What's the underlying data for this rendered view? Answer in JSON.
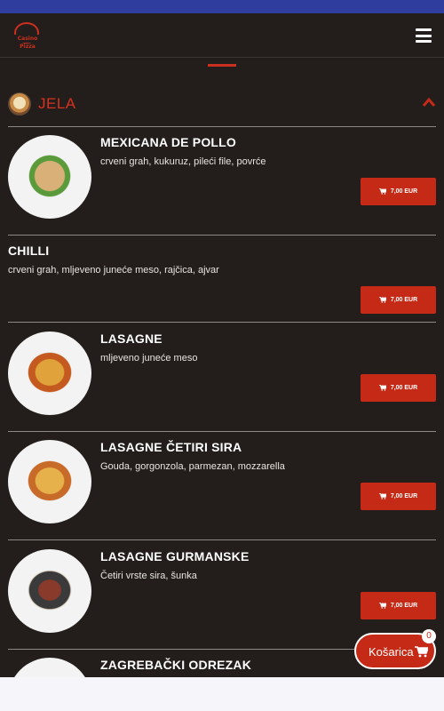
{
  "section": {
    "title": "JELA"
  },
  "logo": {
    "text": "Casino Pizza"
  },
  "items": [
    {
      "name": "MEXICANA DE POLLO",
      "description": "crveni grah, kukuruz, pileći file, povrće",
      "price": "7,00 EUR",
      "photo_icon": "tortilla-wrap"
    },
    {
      "name": "CHILLI",
      "description": "crveni grah, mljeveno juneće meso, rajčica, ajvar",
      "price": "7,00 EUR"
    },
    {
      "name": "LASAGNE",
      "description": "mljeveno juneće meso",
      "price": "7,00 EUR",
      "photo_icon": "lasagne-dish"
    },
    {
      "name": "LASAGNE ČETIRI SIRA",
      "description": "Gouda, gorgonzola, parmezan, mozzarella",
      "price": "7,00 EUR",
      "photo_icon": "lasagne-dish"
    },
    {
      "name": "LASAGNE GURMANSKE",
      "description": "Četiri vrste sira, šunka",
      "price": "7,00 EUR",
      "photo_icon": "lasagne-pan"
    },
    {
      "name": "ZAGREBAČKI ODREZAK",
      "photo_icon": "schnitzel-plate"
    }
  ],
  "cart": {
    "label": "Košarica",
    "count": "0"
  },
  "colors": {
    "accent": "#c52a16",
    "background": "#231e1b",
    "statusbar": "#2f3e9e"
  }
}
